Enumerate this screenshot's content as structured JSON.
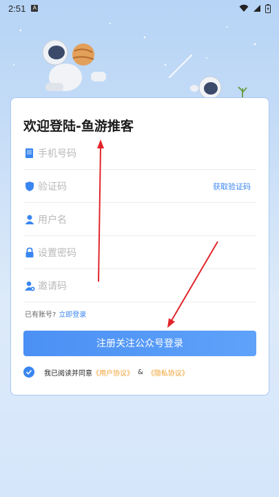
{
  "status_bar": {
    "time": "2:51",
    "notification_badge": "A"
  },
  "form": {
    "title": "欢迎登陆-鱼游推客",
    "phone_placeholder": "手机号码",
    "code_placeholder": "验证码",
    "get_code_label": "获取验证码",
    "username_placeholder": "用户名",
    "password_placeholder": "设置密码",
    "invite_placeholder": "邀请码",
    "have_account_text": "已有账号?",
    "login_link": "立即登录",
    "submit_label": "注册关注公众号登录",
    "agree_text": "我已阅读并同意",
    "user_agreement": "《用户协议》",
    "amp": "&",
    "privacy_policy": "《隐私协议》",
    "agree_checked": true
  },
  "colors": {
    "accent": "#3a86f0",
    "link_orange": "#f0a030",
    "annotation_red": "#e0242a"
  }
}
